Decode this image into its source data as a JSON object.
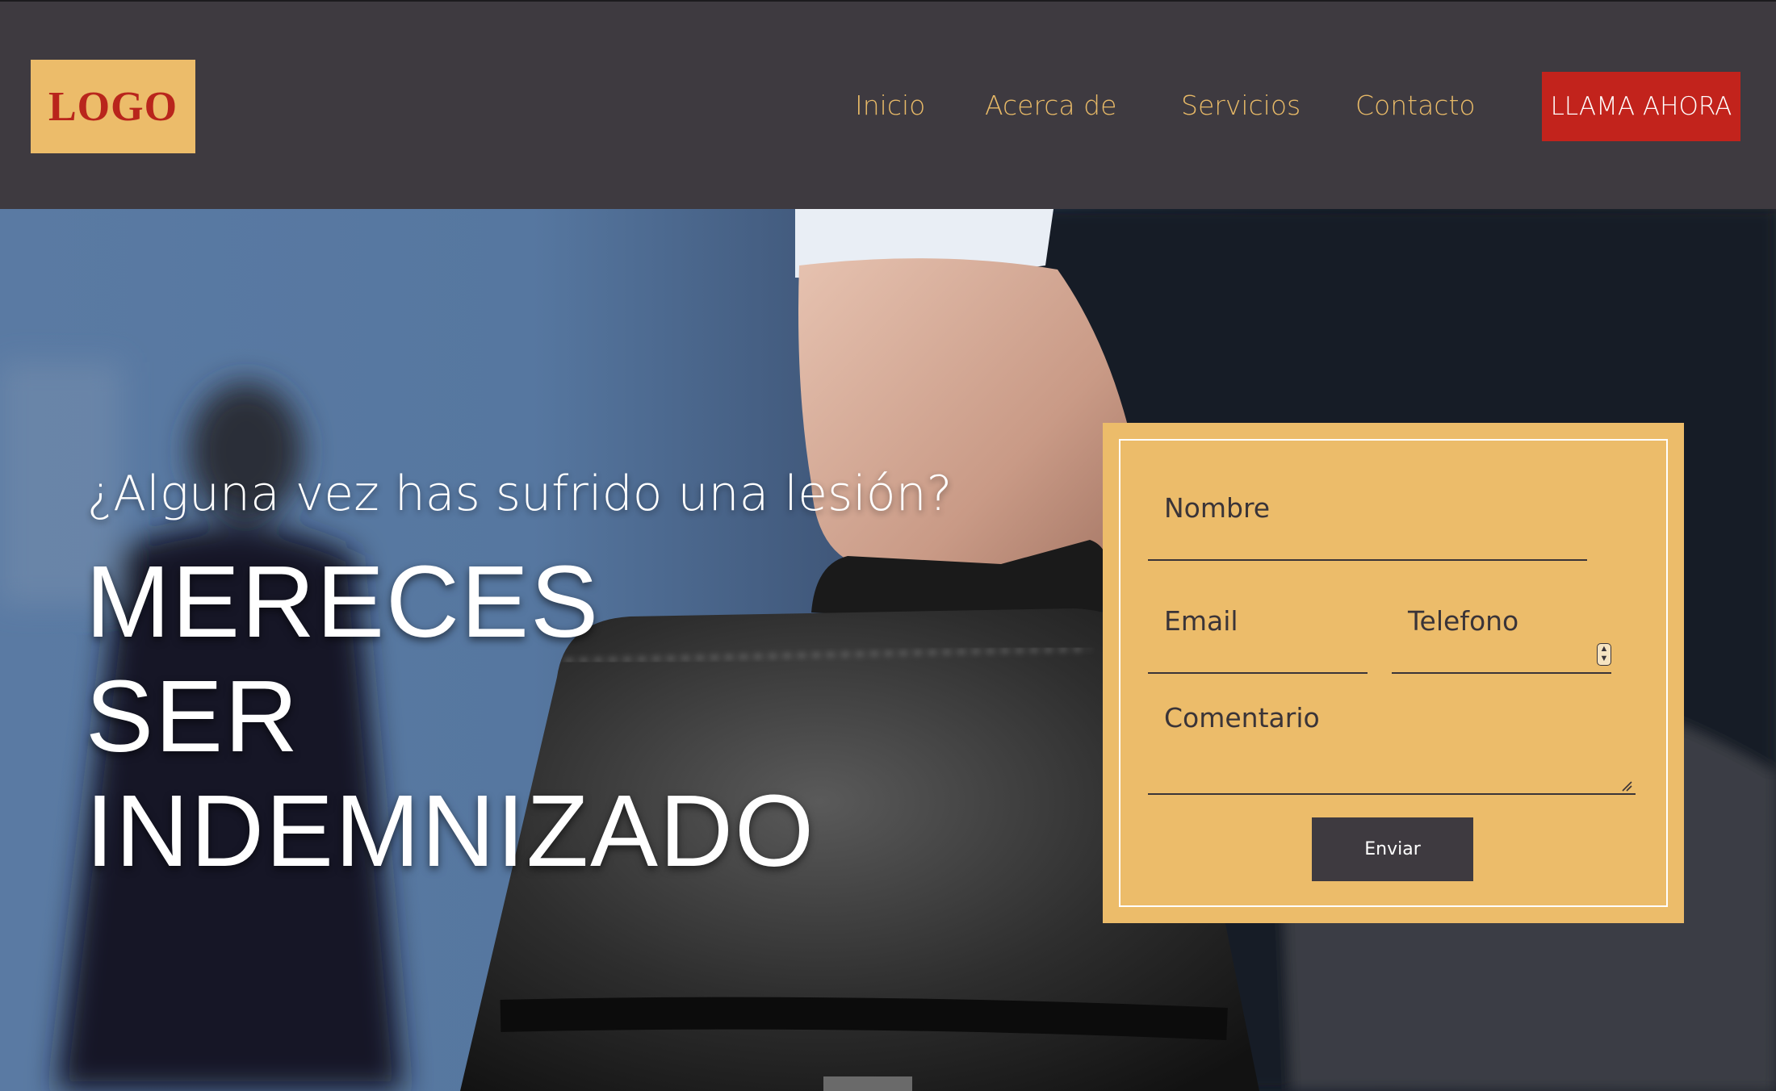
{
  "header": {
    "logo_text": "LOGO",
    "nav": [
      "Inicio",
      "Acerca de",
      "Servicios",
      "Contacto"
    ],
    "cta_label": "LLAMA AHORA"
  },
  "hero": {
    "subtitle": "¿Alguna vez has sufrido una lesión?",
    "headline_lines": [
      "MERECES",
      "SER",
      "INDEMNIZADO"
    ]
  },
  "form": {
    "name_placeholder": "Nombre",
    "email_placeholder": "Email",
    "phone_placeholder": "Telefono",
    "comment_placeholder": "Comentario",
    "submit_label": "Enviar"
  },
  "colors": {
    "header_bg": "#3e3a40",
    "accent_gold": "#ecbc6a",
    "cta_red": "#c2231c",
    "nav_text": "#e7b967"
  },
  "icons": {
    "number_spinner": "spinner-icon",
    "textarea_resize": "resize-handle-icon"
  }
}
